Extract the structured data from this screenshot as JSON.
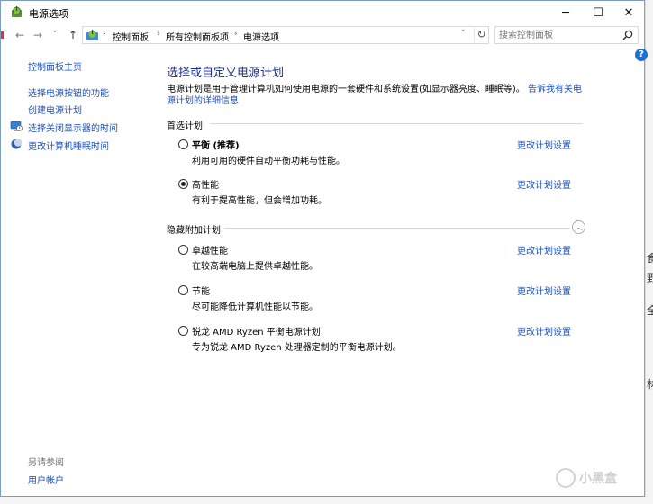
{
  "window": {
    "title": "电源选项",
    "min_glyph": "─",
    "max_glyph": "☐",
    "close_glyph": "✕"
  },
  "addressbar": {
    "back_glyph": "←",
    "forward_glyph": "→",
    "recent_glyph": "˅",
    "up_glyph": "↑",
    "crumb_sep": "›",
    "crumbs": [
      "控制面板",
      "所有控制面板项",
      "电源选项"
    ],
    "dropdown_glyph": "˅",
    "refresh_glyph": "↻",
    "search_placeholder": "搜索控制面板"
  },
  "help_glyph": "?",
  "sidebar": {
    "home": "控制面板主页",
    "items": [
      {
        "label": "选择电源按钮的功能",
        "icon": "none"
      },
      {
        "label": "创建电源计划",
        "icon": "none"
      },
      {
        "label": "选择关闭显示器的时间",
        "icon": "monitor-icon"
      },
      {
        "label": "更改计算机睡眠时间",
        "icon": "moon-icon"
      }
    ],
    "see_also_title": "另请参阅",
    "see_also": [
      "用户帐户"
    ]
  },
  "main": {
    "title": "选择或自定义电源计划",
    "description": "电源计划是用于管理计算机如何使用电源的一套硬件和系统设置(如显示器亮度、睡眠等)。",
    "description_link": "告诉我有关电源计划的详细信息",
    "preferred_title": "首选计划",
    "hidden_title": "隐藏附加计划",
    "change_link": "更改计划设置",
    "collapse_glyph": "︿",
    "preferred_plans": [
      {
        "name": "平衡 (推荐)",
        "desc": "利用可用的硬件自动平衡功耗与性能。",
        "selected": false
      },
      {
        "name": "高性能",
        "desc": "有利于提高性能，但会增加功耗。",
        "selected": true
      }
    ],
    "hidden_plans": [
      {
        "name": "卓越性能",
        "desc": "在较高端电脑上提供卓越性能。",
        "selected": false
      },
      {
        "name": "节能",
        "desc": "尽可能降低计算机性能以节能。",
        "selected": false
      },
      {
        "name": "锐龙 AMD Ryzen  平衡电源计划",
        "desc": "专为锐龙 AMD Ryzen  处理器定制的平衡电源计划。",
        "selected": false
      }
    ]
  },
  "background_window": {
    "glyphs": [
      "食",
      "野",
      "全",
      "林"
    ]
  },
  "watermark": {
    "text": "小黑盒"
  },
  "colors": {
    "link": "#1a4fb8",
    "title": "#1e3287",
    "help": "#1e6fd0"
  }
}
